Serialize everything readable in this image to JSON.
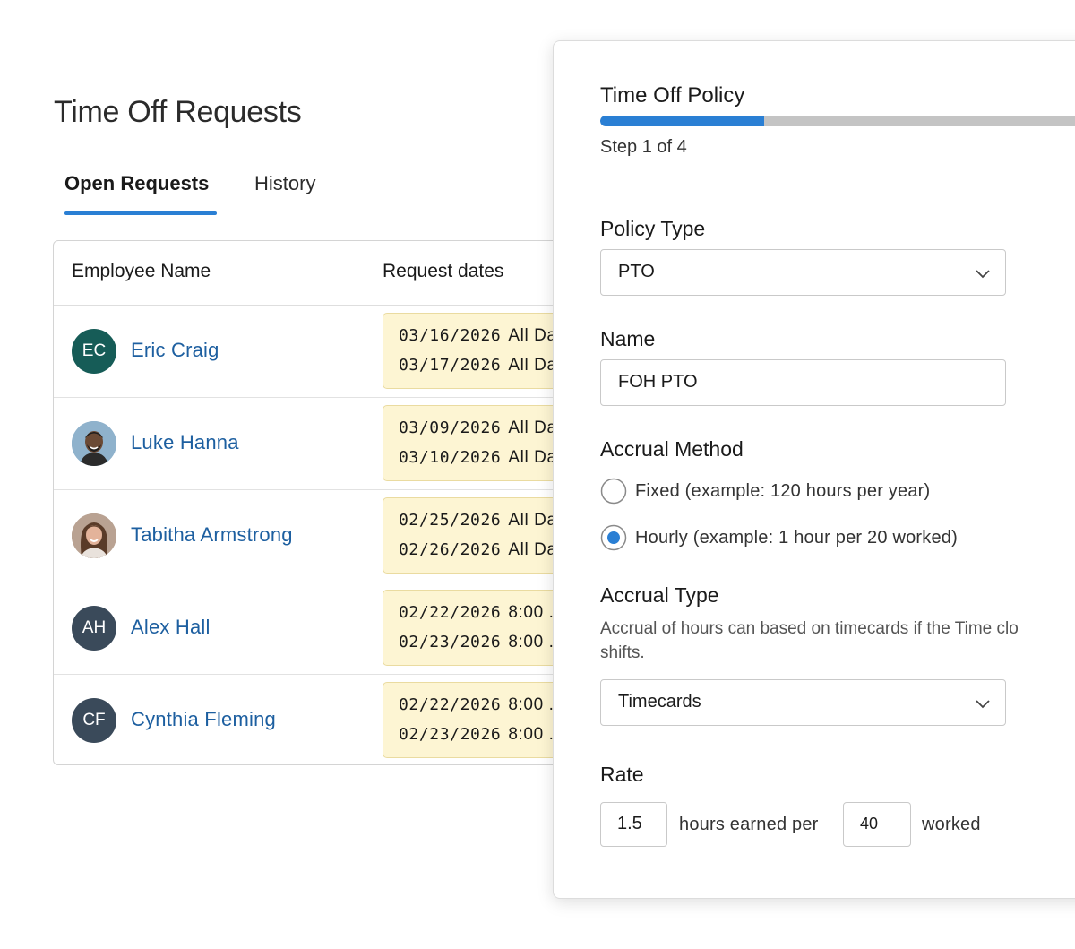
{
  "page": {
    "title": "Time Off Requests"
  },
  "tabs": [
    {
      "label": "Open Requests",
      "active": true
    },
    {
      "label": "History",
      "active": false
    }
  ],
  "table": {
    "columns": [
      "Employee Name",
      "Request dates"
    ],
    "rows": [
      {
        "initials": "EC",
        "avatar_color": "#165c57",
        "photo": false,
        "name": "Eric Craig",
        "dates": [
          {
            "date": "03/16/2026",
            "time": "All Da"
          },
          {
            "date": "03/17/2026",
            "time": "All Da"
          }
        ]
      },
      {
        "initials": "",
        "avatar_color": "#7fa6c4",
        "photo": true,
        "name": "Luke Hanna",
        "dates": [
          {
            "date": "03/09/2026",
            "time": "All Da"
          },
          {
            "date": "03/10/2026",
            "time": "All Da"
          }
        ]
      },
      {
        "initials": "",
        "avatar_color": "#a88f7e",
        "photo": true,
        "name": "Tabitha Armstrong",
        "dates": [
          {
            "date": "02/25/2026",
            "time": "All Da"
          },
          {
            "date": "02/26/2026",
            "time": "All Da"
          }
        ]
      },
      {
        "initials": "AH",
        "avatar_color": "#3a4a5a",
        "photo": false,
        "name": "Alex Hall",
        "dates": [
          {
            "date": "02/22/2026",
            "time": "8:00 ."
          },
          {
            "date": "02/23/2026",
            "time": "8:00 ."
          }
        ]
      },
      {
        "initials": "CF",
        "avatar_color": "#3a4a5a",
        "photo": false,
        "name": "Cynthia Fleming",
        "dates": [
          {
            "date": "02/22/2026",
            "time": "8:00 ."
          },
          {
            "date": "02/23/2026",
            "time": "8:00 ."
          }
        ]
      }
    ]
  },
  "panel": {
    "title": "Time Off Policy",
    "progress": {
      "fraction": 0.305,
      "step_text": "Step 1 of 4"
    },
    "policy_type": {
      "label": "Policy Type",
      "value": "PTO"
    },
    "name": {
      "label": "Name",
      "value": "FOH PTO"
    },
    "accrual_method": {
      "label": "Accrual Method",
      "options": [
        {
          "label": "Fixed (example: 120 hours per year)",
          "selected": false
        },
        {
          "label": "Hourly (example: 1 hour per 20 worked)",
          "selected": true
        }
      ]
    },
    "accrual_type": {
      "label": "Accrual Type",
      "help_line1": "Accrual of hours can based on timecards if the Time clo",
      "help_line2": "shifts.",
      "value": "Timecards"
    },
    "rate": {
      "label": "Rate",
      "hours_value": "1.5",
      "text_mid": "hours earned per",
      "per_value": "40",
      "text_end": "worked"
    }
  },
  "colors": {
    "accent": "#2a7fd4",
    "link": "#1d5fa0",
    "date_bg": "#fdf5d3"
  }
}
